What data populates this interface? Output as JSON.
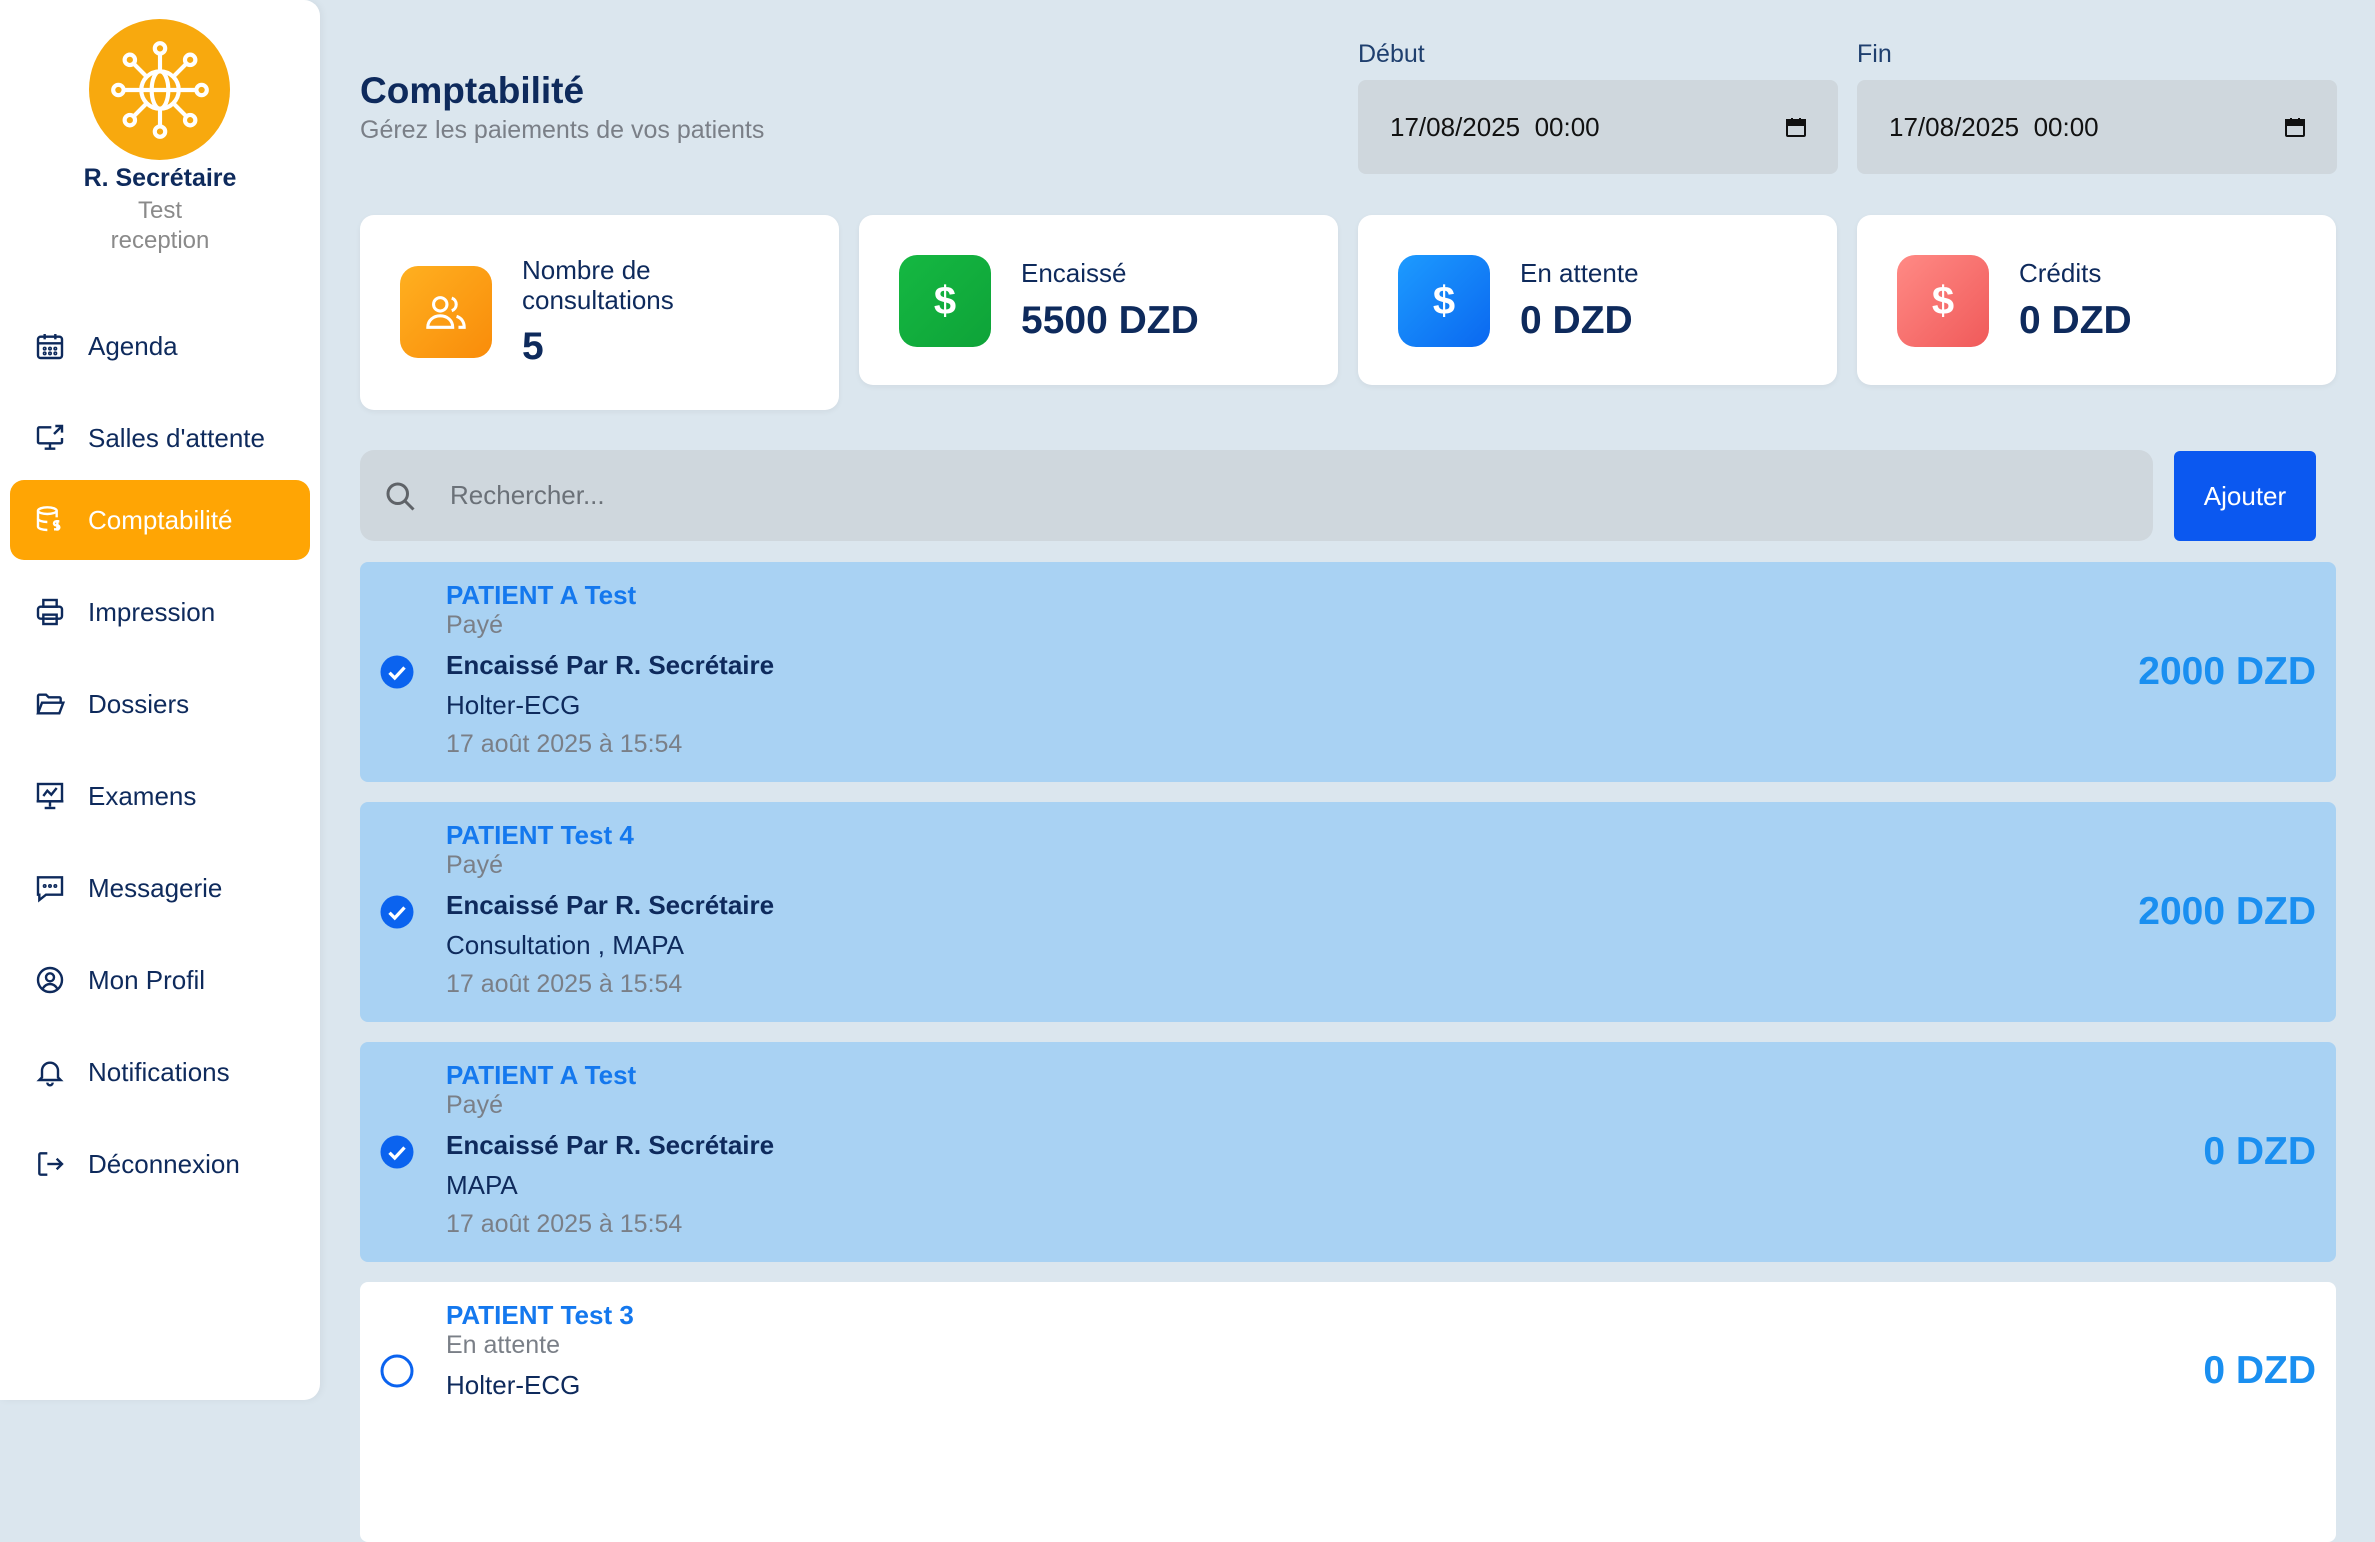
{
  "sidebar": {
    "user_name": "R. Secrétaire",
    "role_line1": "Test",
    "role_line2": "reception",
    "items": [
      {
        "label": "Agenda",
        "icon": "calendar-icon"
      },
      {
        "label": "Salles d'attente",
        "icon": "monitor-icon"
      },
      {
        "label": "Comptabilité",
        "icon": "database-dollar-icon",
        "active": true
      },
      {
        "label": "Impression",
        "icon": "printer-icon"
      },
      {
        "label": "Dossiers",
        "icon": "folder-open-icon"
      },
      {
        "label": "Examens",
        "icon": "presentation-icon"
      },
      {
        "label": "Messagerie",
        "icon": "message-icon"
      },
      {
        "label": "Mon Profil",
        "icon": "user-circle-icon"
      },
      {
        "label": "Notifications",
        "icon": "bell-icon"
      },
      {
        "label": "Déconnexion",
        "icon": "logout-icon"
      }
    ]
  },
  "header": {
    "title": "Comptabilité",
    "subtitle": "Gérez les paiements de vos patients",
    "start_label": "Début",
    "start_value": "17/08/2025  00:00",
    "end_label": "Fin",
    "end_value": "17/08/2025  00:00"
  },
  "stats": {
    "consultations_label_1": "Nombre de",
    "consultations_label_2": "consultations",
    "consultations_value": "5",
    "cashed_label": "Encaissé",
    "cashed_value": "5500 DZD",
    "pending_label": "En attente",
    "pending_value": "0 DZD",
    "credits_label": "Crédits",
    "credits_value": "0 DZD"
  },
  "search": {
    "placeholder": "Rechercher...",
    "add_label": "Ajouter"
  },
  "payments": [
    {
      "name": "PATIENT A Test",
      "status": "Payé",
      "by": "Encaissé Par R. Secrétaire",
      "acts": "Holter-ECG",
      "date": "17 août 2025 à 15:54",
      "amount": "2000 DZD",
      "checked": true
    },
    {
      "name": "PATIENT Test 4",
      "status": "Payé",
      "by": "Encaissé Par R. Secrétaire",
      "acts": "Consultation , MAPA",
      "date": "17 août 2025 à 15:54",
      "amount": "2000 DZD",
      "checked": true
    },
    {
      "name": "PATIENT A Test",
      "status": "Payé",
      "by": "Encaissé Par R. Secrétaire",
      "acts": "MAPA",
      "date": "17 août 2025 à 15:54",
      "amount": "0 DZD",
      "checked": true
    },
    {
      "name": "PATIENT Test 3",
      "status": "En attente",
      "acts": "Holter-ECG",
      "amount": "0 DZD",
      "checked": false
    }
  ],
  "colors": {
    "accent": "#ffa504",
    "primary_button": "#0b58f0",
    "paid_row": "#a9d2f3",
    "cashed_green": "#12b03e",
    "pending_blue": "#0b7cf5",
    "credits_red": "#f56b6b",
    "consultations_orange": "#fb9a12"
  }
}
